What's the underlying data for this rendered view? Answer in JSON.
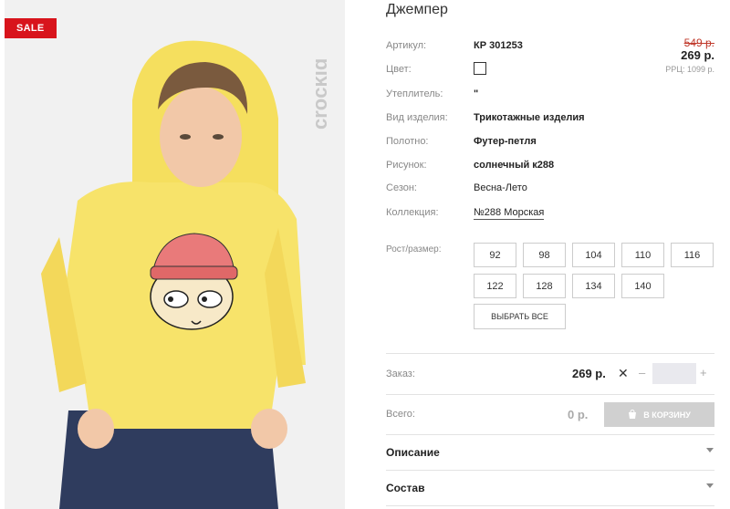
{
  "badge": "SALE",
  "product": {
    "title": "Джемпер",
    "attributes": [
      {
        "label": "Артикул:",
        "value": "КР 301253"
      },
      {
        "label": "Цвет:",
        "value": ""
      },
      {
        "label": "Утеплитель:",
        "value": "\""
      },
      {
        "label": "Вид изделия:",
        "value": "Трикотажные изделия"
      },
      {
        "label": "Полотно:",
        "value": "Футер-петля"
      },
      {
        "label": "Рисунок:",
        "value": "солнечный к288"
      },
      {
        "label": "Сезон:",
        "value": "Весна-Лето"
      },
      {
        "label": "Коллекция:",
        "value": "№288 Морская"
      }
    ],
    "color_swatch": "#ffffff"
  },
  "price": {
    "old": "549 р.",
    "new": "269 р.",
    "rrc": "РРЦ: 1099 р."
  },
  "sizes": {
    "label": "Рост/размер:",
    "options": [
      "92",
      "98",
      "104",
      "110",
      "116",
      "122",
      "128",
      "134",
      "140"
    ],
    "select_all": "ВЫБРАТЬ ВСЕ"
  },
  "order": {
    "label": "Заказ:",
    "price": "269 р.",
    "quantity": "",
    "minus": "–",
    "plus": "+"
  },
  "total": {
    "label": "Всего:",
    "value": "0 р.",
    "cart_button": "В КОРЗИНУ"
  },
  "accordions": [
    "Описание",
    "Состав"
  ],
  "colors": {
    "sale_red": "#d8141c",
    "hoodie_yellow": "#f7e36a",
    "pants_navy": "#2f3c5e",
    "cart_disabled": "#d0d0d0"
  }
}
